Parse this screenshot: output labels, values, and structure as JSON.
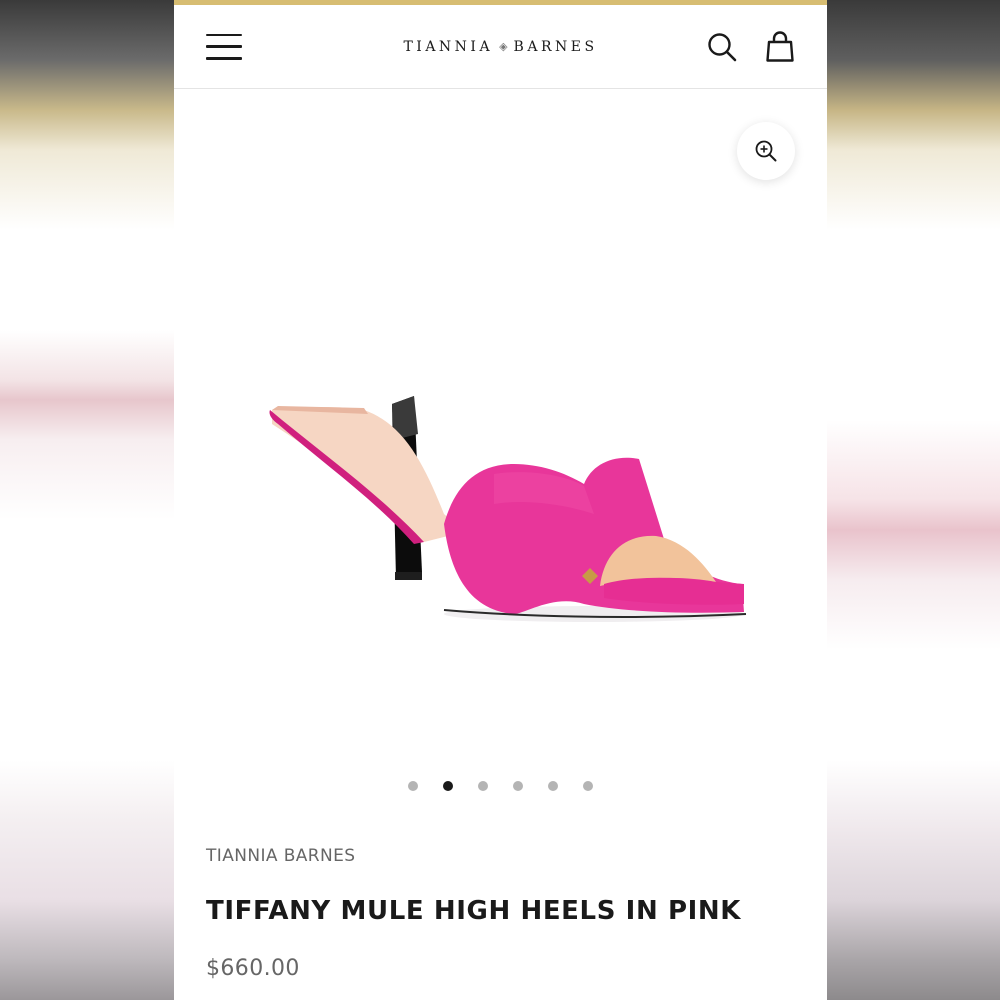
{
  "header": {
    "brand_left": "TIANNIA",
    "brand_mark": "◈",
    "brand_right": "BARNES",
    "menu_icon": "hamburger-menu-icon",
    "search_icon": "search-icon",
    "cart_icon": "shopping-bag-icon"
  },
  "colors": {
    "accent_top_bar": "#d7bd72",
    "product_pink": "#e8369a",
    "text_dark": "#1a1a1a",
    "text_muted": "#666666"
  },
  "gallery": {
    "zoom_icon": "zoom-in-icon",
    "image_alt": "pink open-toe mule with black block heel",
    "slide_count": 6,
    "active_slide": 2
  },
  "product": {
    "brand": "TIANNIA BARNES",
    "title": "TIFFANY MULE HIGH HEELS IN PINK",
    "price": "$660.00"
  }
}
